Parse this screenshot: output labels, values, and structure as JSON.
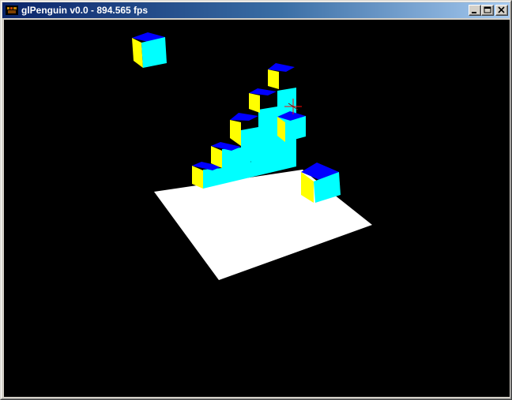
{
  "window": {
    "title": "glPenguin v0.0 - 894.565 fps",
    "icon": "app-icon",
    "controls": [
      "minimize-icon",
      "maximize-icon",
      "close-icon"
    ]
  },
  "viewport": {
    "background": "#000000",
    "colors": {
      "cube_top": "#0000ff",
      "cube_front": "#00ffff",
      "cube_side": "#ffff00",
      "floor": "#ffffff",
      "cursor": "#ff0000"
    }
  }
}
